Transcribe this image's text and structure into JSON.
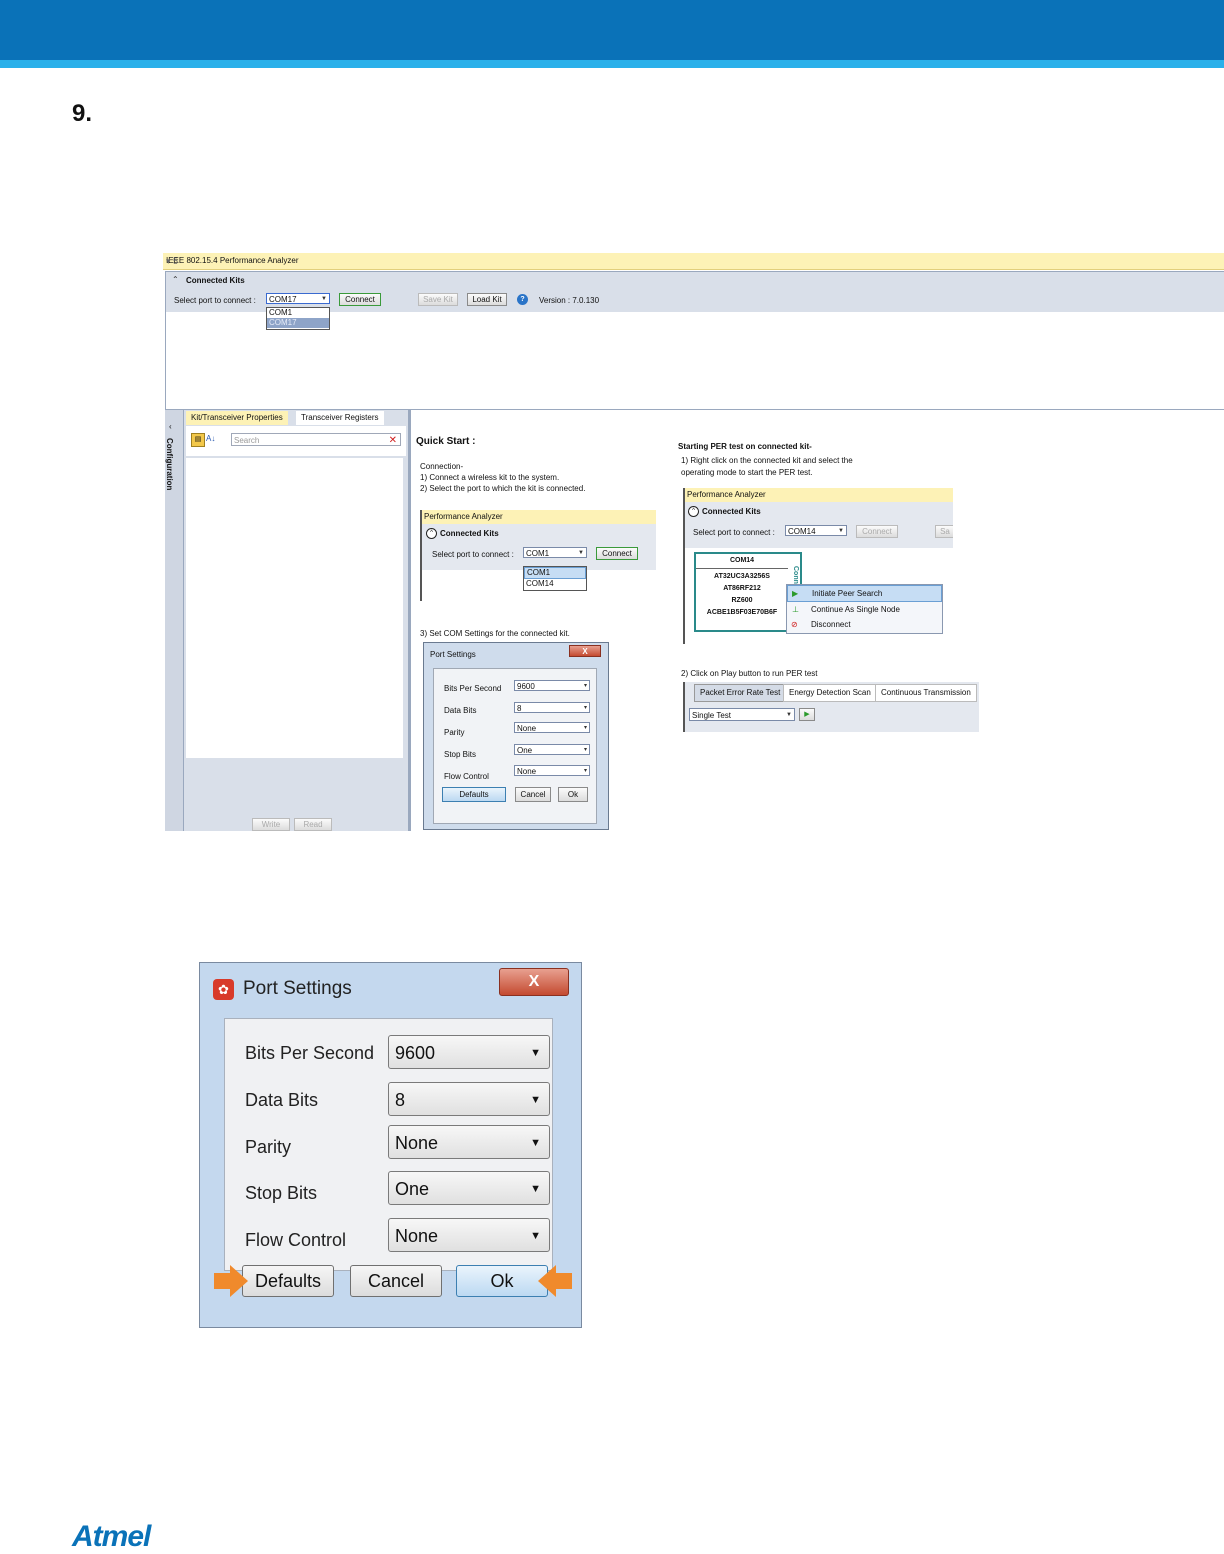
{
  "step_number": "9.",
  "analyzer": {
    "window_title": "IEEE 802.15.4 Performance Analyzer",
    "window_controls": "▾ 5",
    "connected_kits_title": "Connected Kits",
    "select_port_label": "Select port to connect :",
    "port_selected": "COM17",
    "port_options": [
      "COM1",
      "COM17"
    ],
    "connect_label": "Connect",
    "save_kit_label": "Save Kit",
    "load_kit_label": "Load Kit",
    "version": "Version : 7.0.130",
    "sidebar_label": "Configuration",
    "tabs": [
      "Kit/Transceiver Properties",
      "Transceiver Registers"
    ],
    "search_placeholder": "Search",
    "write_label": "Write",
    "read_label": "Read"
  },
  "quick_start": {
    "title": "Quick Start :",
    "connection_title": "Connection-",
    "connection_step1": "1) Connect a wireless kit to the system.",
    "connection_step2": "2) Select the port to which the kit is connected.",
    "mini_window_title": "Performance Analyzer",
    "mini_connected_kits": "Connected Kits",
    "mini_select_port": "Select port to connect :",
    "mini_port_selected": "COM1",
    "mini_port_options": [
      "COM1",
      "COM14"
    ],
    "mini_connect": "Connect",
    "step3": "3) Set COM Settings for the connected kit."
  },
  "per_test": {
    "title": "Starting PER test on connected kit-",
    "step1_line1": "1) Right click on the connected kit and select the",
    "step1_line2": "operating mode to start the PER test.",
    "mini_window_title": "Performance Analyzer",
    "mini_connected_kits": "Connected Kits",
    "mini_select_port": "Select port to connect :",
    "mini_port_selected": "COM14",
    "mini_connect": "Connect",
    "mini_save": "Sa",
    "kit_port": "COM14",
    "kit_mcu": "AT32UC3A3256S",
    "kit_transceiver": "AT86RF212",
    "kit_board": "RZ600",
    "kit_mac": "ACBE1B5F03E70B6F",
    "kit_status": "Connected",
    "context_menu": [
      "Initiate Peer Search",
      "Continue As Single Node",
      "Disconnect"
    ],
    "step2": "2) Click on Play button to run PER test",
    "test_tabs": [
      "Packet Error Rate Test",
      "Energy Detection Scan",
      "Continuous Transmission"
    ],
    "test_mode": "Single Test"
  },
  "port_settings": {
    "title": "Port Settings",
    "close_label": "X",
    "fields": [
      {
        "label": "Bits Per Second",
        "value": "9600"
      },
      {
        "label": "Data Bits",
        "value": "8"
      },
      {
        "label": "Parity",
        "value": "None"
      },
      {
        "label": "Stop Bits",
        "value": "One"
      },
      {
        "label": "Flow Control",
        "value": "None"
      }
    ],
    "defaults_label": "Defaults",
    "cancel_label": "Cancel",
    "ok_label": "Ok"
  },
  "logo_text": "Atmel",
  "colors": {
    "brand_blue": "#0a72b8",
    "accent_cyan": "#2ab0ea",
    "arrow_orange": "#f08a2c"
  }
}
